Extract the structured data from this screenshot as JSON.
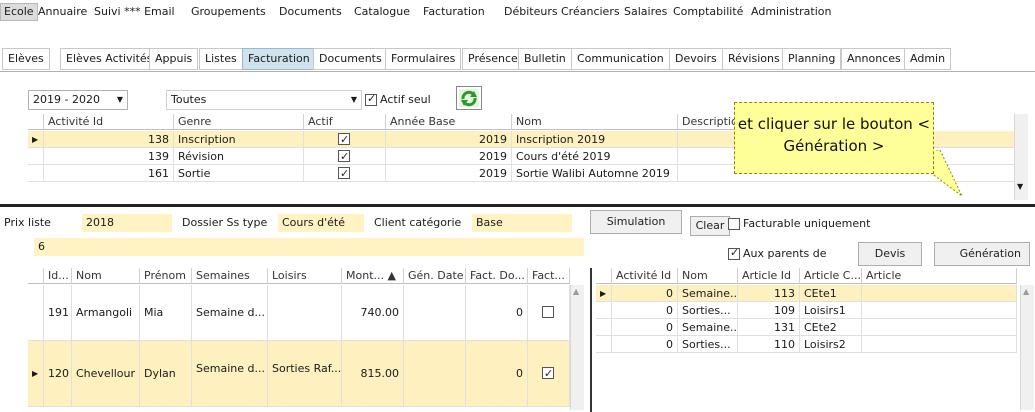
{
  "top_menu": [
    "Ecole",
    "Annuaire",
    "Suivi *** Email",
    "Groupements",
    "Documents",
    "Catalogue",
    "Facturation",
    "Débiteurs",
    "Créanciers",
    "Salaires",
    "Comptabilité",
    "Administration"
  ],
  "sub_tabs": [
    "Elèves",
    "Elèves Activités",
    "Appuis",
    "Listes",
    "Facturation",
    "Documents",
    "Formulaires",
    "Présence",
    "Bulletin",
    "Communication",
    "Devoirs",
    "Révisions",
    "Planning",
    "Annonces",
    "Admin"
  ],
  "filters": {
    "year": "2019 - 2020",
    "genre": "Toutes",
    "actif_label": "Actif seul"
  },
  "activity_table": {
    "headers": [
      "Activité Id",
      "Genre",
      "Actif",
      "Année Base",
      "Nom",
      "Descriptio"
    ],
    "rows": [
      {
        "id": "138",
        "genre": "Inscription",
        "actif": true,
        "annee": "2019",
        "nom": "Inscription 2019"
      },
      {
        "id": "139",
        "genre": "Révision",
        "actif": true,
        "annee": "2019",
        "nom": "Cours d'été 2019"
      },
      {
        "id": "161",
        "genre": "Sortie",
        "actif": true,
        "annee": "2019",
        "nom": "Sortie Walibi Automne 2019"
      }
    ]
  },
  "callout": {
    "line1": "et cliquer sur le bouton <",
    "line2": "Génération >"
  },
  "form": {
    "prix_liste_label": "Prix liste",
    "prix_liste_value": "2018",
    "dossier_label": "Dossier Ss type",
    "dossier_value": "Cours d'été",
    "client_label": "Client catégorie",
    "client_value": "Base",
    "count": "6"
  },
  "buttons": {
    "simulation": "Simulation",
    "clear": "Clear",
    "facturable_label": "Facturable uniquement",
    "aux_parents_label": "Aux parents de",
    "devis": "Devis",
    "generation": "Génération"
  },
  "students_table": {
    "headers": [
      "Id...",
      "Nom",
      "Prénom",
      "Semaines",
      "Loisirs",
      "Mont... ▲",
      "Gén. Date",
      "Fact. Do...",
      "Fact..."
    ],
    "rows": [
      {
        "id": "191",
        "nom": "Armangoli",
        "prenom": "Mia",
        "semaines": "Semaine d...",
        "loisirs": "",
        "montant": "740.00",
        "gen_date": "",
        "fact_do": "0",
        "fact": false
      },
      {
        "id": "120",
        "nom": "Chevellour",
        "prenom": "Dylan",
        "semaines": "Semaine d...",
        "loisirs": "Sorties Raf...",
        "montant": "815.00",
        "gen_date": "",
        "fact_do": "0",
        "fact": true
      }
    ]
  },
  "articles_table": {
    "headers": [
      "Activité Id",
      "Nom",
      "Article Id",
      "Article C...",
      "Article"
    ],
    "rows": [
      {
        "act": "0",
        "nom": "Semaine...",
        "art_id": "113",
        "art_c": "CEte1"
      },
      {
        "act": "0",
        "nom": "Sorties...",
        "art_id": "109",
        "art_c": "Loisirs1"
      },
      {
        "act": "0",
        "nom": "Semaine...",
        "art_id": "131",
        "art_c": "CEte2"
      },
      {
        "act": "0",
        "nom": "Sorties...",
        "art_id": "110",
        "art_c": "Loisirs2"
      }
    ]
  },
  "colors": {
    "selected_row": "#fff0c0",
    "active_tab": "#cfe3ef",
    "callout": "#ffff99"
  }
}
